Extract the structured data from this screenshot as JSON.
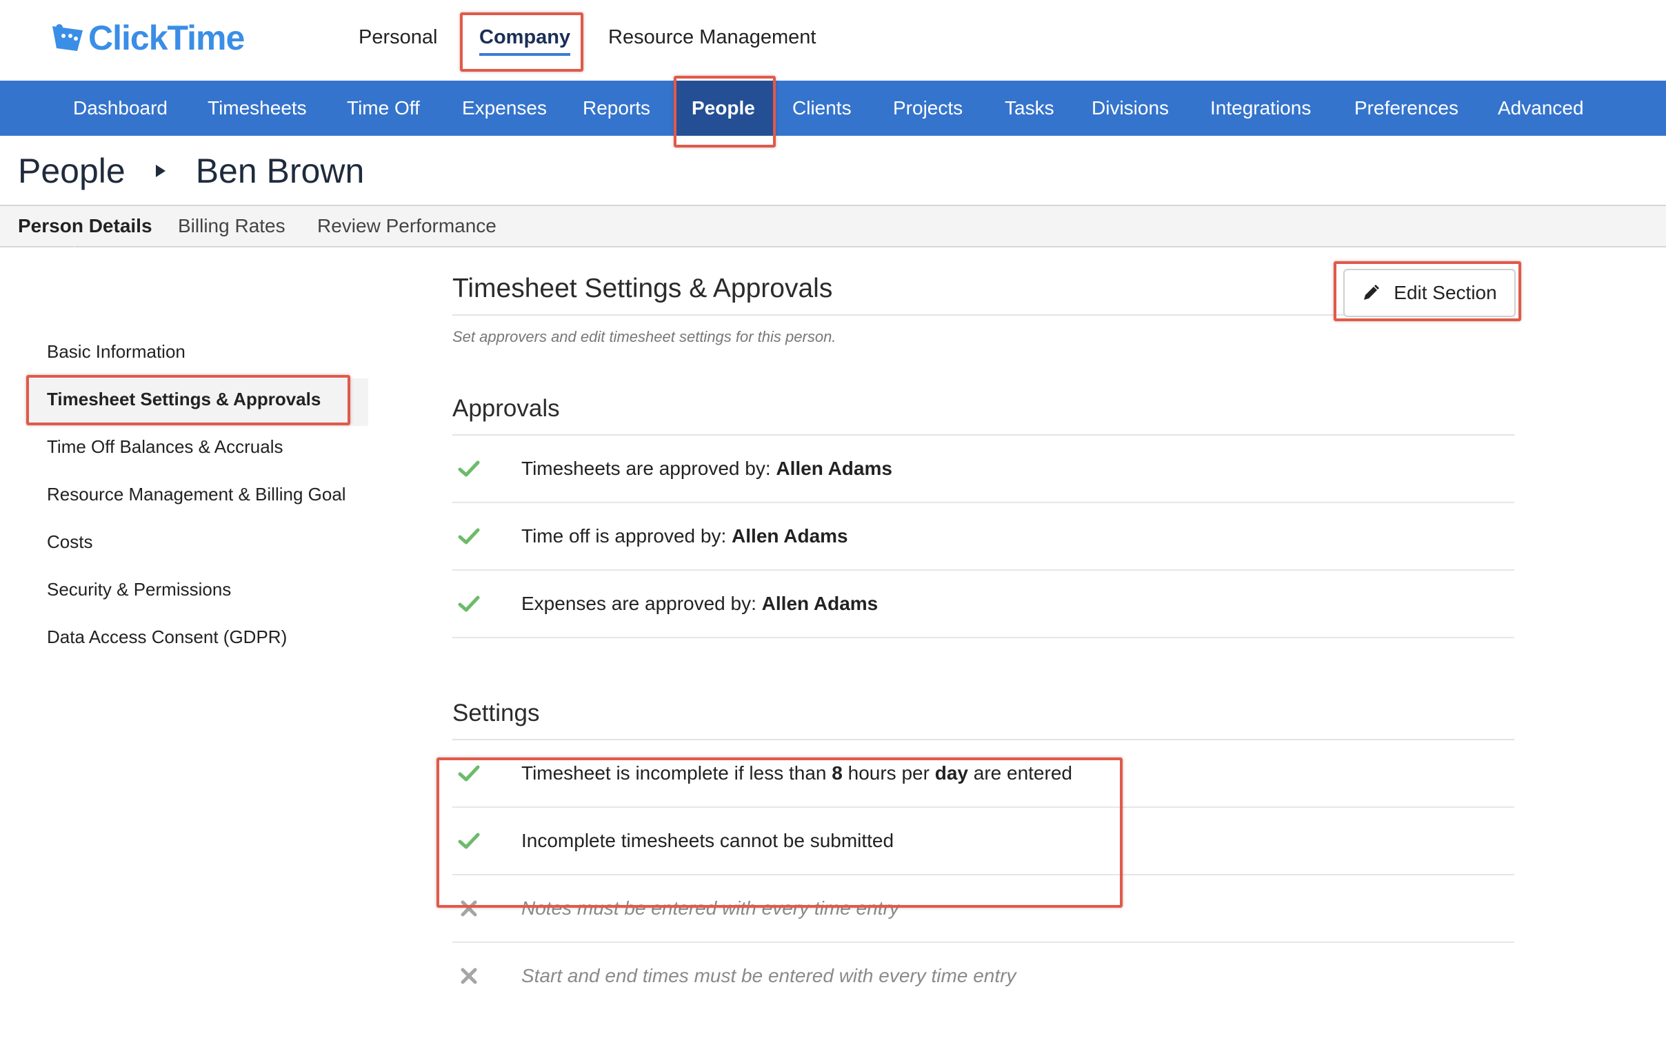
{
  "app": {
    "logo_text": "ClickTime"
  },
  "topnav": [
    {
      "label": "Personal"
    },
    {
      "label": "Company"
    },
    {
      "label": "Resource Management"
    }
  ],
  "mainnav": [
    {
      "label": "Dashboard"
    },
    {
      "label": "Timesheets"
    },
    {
      "label": "Time Off"
    },
    {
      "label": "Expenses"
    },
    {
      "label": "Reports"
    },
    {
      "label": "People"
    },
    {
      "label": "Clients"
    },
    {
      "label": "Projects"
    },
    {
      "label": "Tasks"
    },
    {
      "label": "Divisions"
    },
    {
      "label": "Integrations"
    },
    {
      "label": "Preferences"
    },
    {
      "label": "Advanced"
    }
  ],
  "breadcrumb": {
    "parent": "People",
    "current": "Ben Brown"
  },
  "subtabs": [
    {
      "label": "Person Details"
    },
    {
      "label": "Billing Rates"
    },
    {
      "label": "Review Performance"
    }
  ],
  "sidenav": [
    {
      "label": "Basic Information"
    },
    {
      "label": "Timesheet Settings & Approvals"
    },
    {
      "label": "Time Off Balances & Accruals"
    },
    {
      "label": "Resource Management & Billing Goal"
    },
    {
      "label": "Costs"
    },
    {
      "label": "Security & Permissions"
    },
    {
      "label": "Data Access Consent (GDPR)"
    }
  ],
  "section": {
    "title": "Timesheet Settings & Approvals",
    "description": "Set approvers and edit timesheet settings for this person.",
    "edit_label": "Edit Section"
  },
  "approvals": {
    "title": "Approvals",
    "rows": [
      {
        "prefix": "Timesheets are approved by: ",
        "approver": "Allen Adams"
      },
      {
        "prefix": "Time off is approved by: ",
        "approver": "Allen Adams"
      },
      {
        "prefix": "Expenses are approved by: ",
        "approver": "Allen Adams"
      }
    ]
  },
  "settings": {
    "title": "Settings",
    "incomplete_rule": {
      "pre": "Timesheet is incomplete if less than ",
      "hours": "8",
      "mid": " hours per ",
      "period": "day",
      "post": " are entered"
    },
    "cannot_submit": "Incomplete timesheets cannot be submitted",
    "notes_required": "Notes must be entered with every time entry",
    "start_end_required": "Start and end times must be entered with every time entry"
  },
  "colors": {
    "nav_blue": "#3574cc",
    "nav_active": "#254f94",
    "check_green": "#6dbb6a",
    "cross_gray": "#a5a5a5",
    "highlight_red": "#e05a4a"
  }
}
